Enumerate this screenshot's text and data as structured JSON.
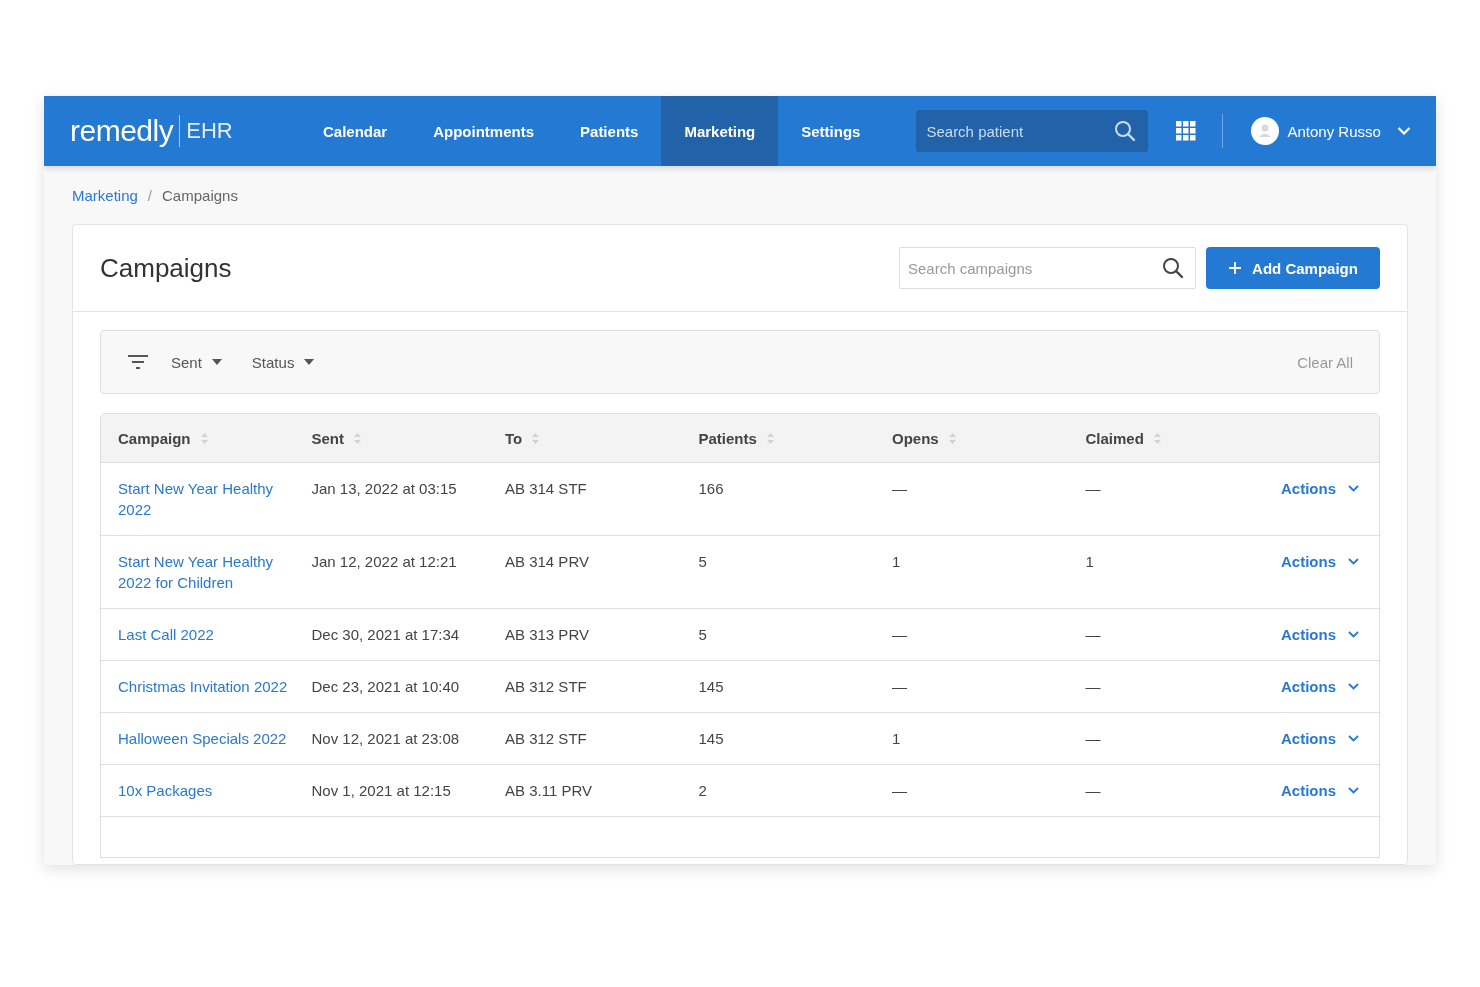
{
  "brand": {
    "name": "remedly",
    "product": "EHR"
  },
  "nav": [
    {
      "label": "Calendar",
      "selected": false
    },
    {
      "label": "Appointments",
      "selected": false
    },
    {
      "label": "Patients",
      "selected": false
    },
    {
      "label": "Marketing",
      "selected": true
    },
    {
      "label": "Settings",
      "selected": false
    }
  ],
  "patient_search": {
    "placeholder": "Search patient"
  },
  "user": {
    "name": "Antony Russo"
  },
  "breadcrumb": [
    {
      "label": "Marketing",
      "kind": "link"
    },
    {
      "label": "/",
      "kind": "separator"
    },
    {
      "label": "Campaigns",
      "kind": "current"
    }
  ],
  "page_title": "Campaigns",
  "campaign_search": {
    "placeholder": "Search campaigns"
  },
  "add_button": "Add Campaign",
  "filters": [
    {
      "label": "Sent"
    },
    {
      "label": "Status"
    }
  ],
  "clear_all": "Clear All",
  "table": {
    "columns": [
      "Campaign",
      "Sent",
      "To",
      "Patients",
      "Opens",
      "Claimed"
    ],
    "rows": [
      {
        "campaign": "Start New Year Healthy 2022",
        "sent": "Jan 13, 2022 at 03:15",
        "to": "AB 314 STF",
        "patients": "166",
        "opens": "—",
        "claimed": "—",
        "action": "Actions"
      },
      {
        "campaign": "Start New Year Healthy 2022 for Children",
        "sent": "Jan 12, 2022 at 12:21",
        "to": "AB 314 PRV",
        "patients": "5",
        "opens": "1",
        "claimed": "1",
        "action": "Actions"
      },
      {
        "campaign": "Last Call 2022",
        "sent": "Dec 30, 2021 at 17:34",
        "to": "AB 313 PRV",
        "patients": "5",
        "opens": "—",
        "claimed": "—",
        "action": "Actions"
      },
      {
        "campaign": "Christmas Invitation 2022",
        "sent": "Dec 23, 2021 at 10:40",
        "to": "AB 312 STF",
        "patients": "145",
        "opens": "—",
        "claimed": "—",
        "action": "Actions"
      },
      {
        "campaign": "Halloween Specials 2022",
        "sent": "Nov 12, 2021 at 23:08",
        "to": "AB 312 STF",
        "patients": "145",
        "opens": "1",
        "claimed": "—",
        "action": "Actions"
      },
      {
        "campaign": "10x Packages",
        "sent": "Nov 1, 2021 at 12:15",
        "to": "AB 3.11 PRV",
        "patients": "2",
        "opens": "—",
        "claimed": "—",
        "action": "Actions"
      }
    ]
  }
}
